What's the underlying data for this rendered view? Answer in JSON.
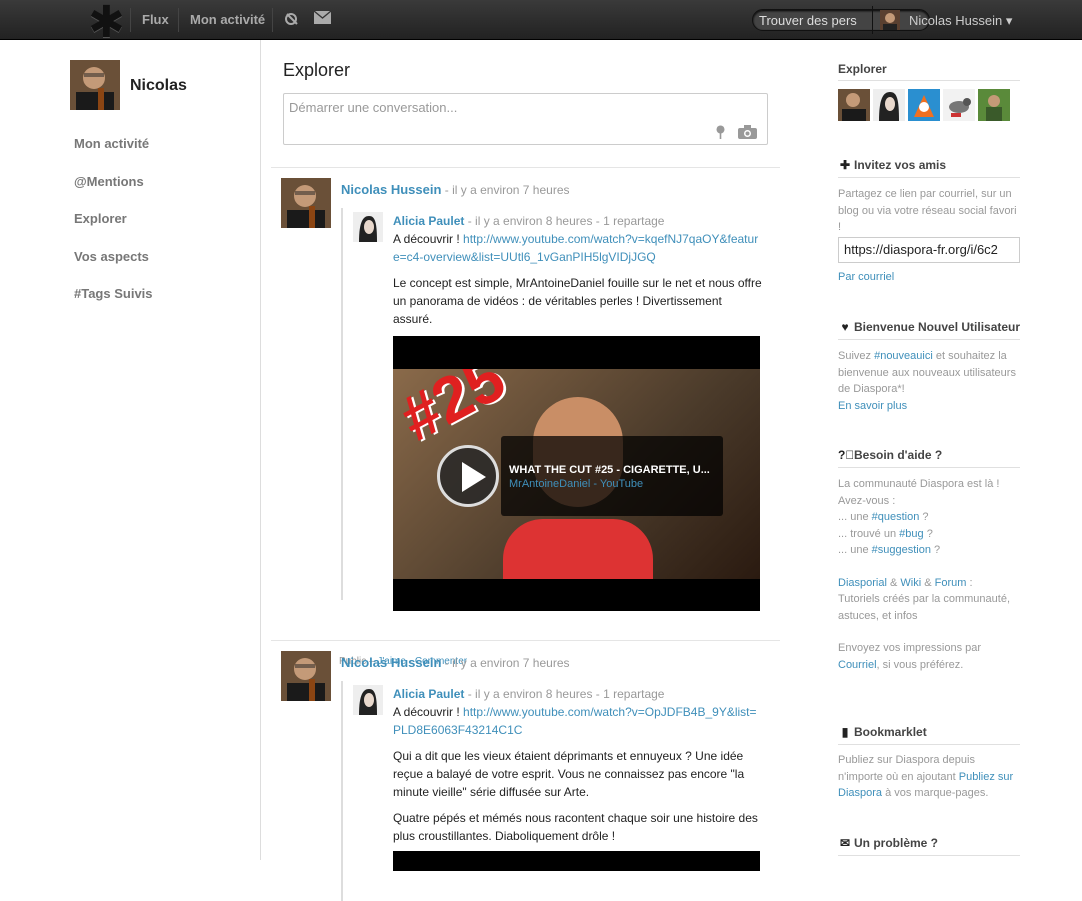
{
  "topbar": {
    "logo": "✱",
    "nav": [
      "Flux",
      "Mon activité"
    ],
    "search_placeholder": "Trouver des pers",
    "user_name": "Nicolas Hussein ▾"
  },
  "left": {
    "name": "Nicolas",
    "nav": [
      "Mon activité",
      "@Mentions",
      "Explorer",
      "Vos aspects",
      "#Tags Suivis"
    ]
  },
  "main": {
    "title": "Explorer",
    "publisher_placeholder": "Démarrer une conversation...",
    "posts": [
      {
        "author": "Nicolas Hussein",
        "time": " - il y a environ 7 heures",
        "reshare_author": "Alicia Paulet",
        "reshare_meta": " - il y a environ 8 heures - 1 repartage",
        "intro": "A découvrir ! ",
        "link": "http://www.youtube.com/watch?v=kqefNJ7qaOY&feature=c4-overview&list=UUtl6_1vGanPIH5lgVIDjJGQ",
        "paragraphs": [
          "Le concept est simple, MrAntoineDaniel fouille sur le net et nous offre un panorama de vidéos : de véritables perles ! Divertissement assuré."
        ],
        "video_title": "WHAT THE CUT #25 - CIGARETTE, U...",
        "video_channel": "MrAntoineDaniel",
        "video_source": "YouTube",
        "video_badge": "#25",
        "footer_prefix": "Public – ",
        "like": "J'aime",
        "comment": "Commenter"
      },
      {
        "author": "Nicolas Hussein",
        "time": " - il y a environ 7 heures",
        "reshare_author": "Alicia Paulet",
        "reshare_meta": " - il y a environ 8 heures - 1 repartage",
        "intro": "A découvrir ! ",
        "link": "http://www.youtube.com/watch?v=OpJDFB4B_9Y&list=PLD8E6063F43214C1C",
        "paragraphs": [
          "Qui a dit que les vieux étaient déprimants et ennuyeux ? Une idée reçue a balayé de votre esprit. Vous ne connaissez pas encore \"la minute vieille\" série diffusée sur Arte.",
          "Quatre pépés et mémés nous racontent chaque soir une histoire des plus croustillantes. Diaboliquement drôle !"
        ]
      }
    ]
  },
  "right": {
    "explorer_title": "Explorer",
    "invite_title": "Invitez vos amis",
    "invite_text": "Partagez ce lien par courriel, sur un blog ou via votre réseau social favori !",
    "invite_link": "https://diaspora-fr.org/i/6c2",
    "invite_email": "Par courriel",
    "welcome_title": "Bienvenue Nouvel Utilisateur",
    "welcome_text_1": "Suivez ",
    "welcome_tag": "#nouveauici",
    "welcome_text_2": " et souhaitez la bienvenue aux nouveaux utilisateurs de Diaspora*!",
    "welcome_more": "En savoir plus",
    "help_title": "Besoin d'aide ?",
    "help_line1": "La communauté Diaspora est là !",
    "help_line2": "Avez-vous :",
    "help_q_prefix": "... une ",
    "help_q_tag": "#question",
    "help_b_prefix": "... trouvé un ",
    "help_b_tag": "#bug",
    "help_s_prefix": "... une ",
    "help_s_tag": "#suggestion",
    "help_links": [
      "Diasporial",
      "Wiki",
      "Forum"
    ],
    "help_links_suffix": " :",
    "help_tutorials": "Tutoriels créés par la communauté, astuces, et infos",
    "help_feedback": "Envoyez vos impressions par",
    "help_email": "Courriel",
    "help_feedback_end": ", si vous préférez.",
    "bookmarklet_title": "Bookmarklet",
    "bookmarklet_text": "Publiez sur Diaspora depuis n'importe où en ajoutant ",
    "bookmarklet_link": "Publiez sur Diaspora",
    "bookmarklet_end": " à vos marque-pages.",
    "problem_title": "Un problème ?"
  }
}
